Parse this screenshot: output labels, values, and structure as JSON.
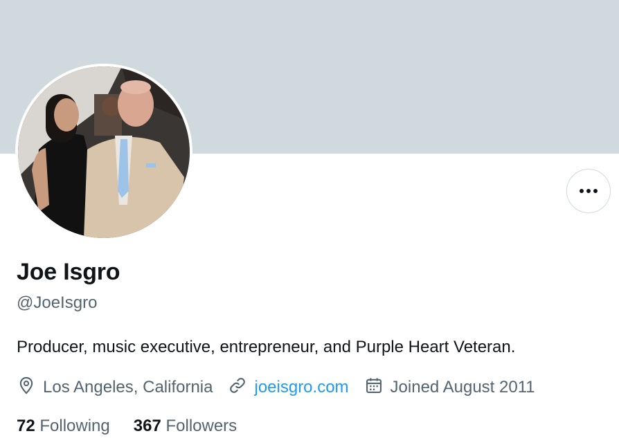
{
  "profile": {
    "display_name": "Joe Isgro",
    "handle": "@JoeIsgro",
    "bio": "Producer, music executive, entrepreneur, and Purple Heart Veteran.",
    "location": "Los Angeles, California",
    "website": "joeisgro.com",
    "joined": "Joined August 2011"
  },
  "stats": {
    "following_count": "72",
    "following_label": "Following",
    "followers_count": "367",
    "followers_label": "Followers"
  },
  "icons": {
    "location": "location-pin-icon",
    "link": "link-icon",
    "calendar": "calendar-icon",
    "more": "more-horizontal-icon"
  },
  "colors": {
    "banner": "#cfd9de",
    "link": "#1d9bf0",
    "secondary_text": "#536471",
    "primary_text": "#0f1419"
  }
}
